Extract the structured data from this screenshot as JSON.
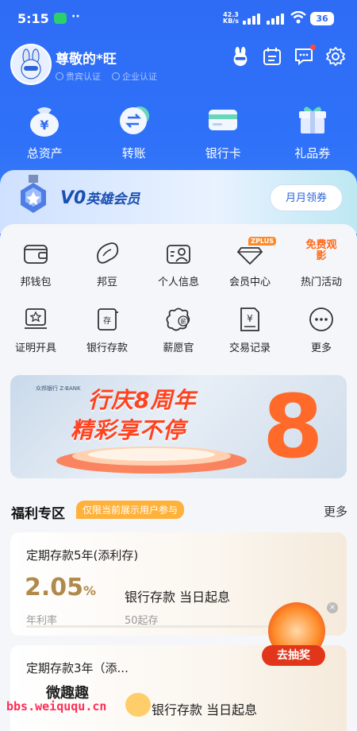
{
  "status": {
    "time": "5:15",
    "net_speed": "42.3",
    "net_unit": "KB/s",
    "battery": "36"
  },
  "profile": {
    "name": "尊敬的*旺",
    "badge_vip": "贵宾认证",
    "badge_ent": "企业认证"
  },
  "quick": [
    {
      "label": "总资产",
      "icon": "money-bag-icon"
    },
    {
      "label": "转账",
      "icon": "transfer-icon"
    },
    {
      "label": "银行卡",
      "icon": "bank-card-icon"
    },
    {
      "label": "礼品券",
      "icon": "gift-icon"
    }
  ],
  "vip": {
    "level": "V0",
    "title": "英雄会员",
    "button": "月月领券"
  },
  "services": [
    {
      "label": "邦钱包",
      "icon": "wallet-icon"
    },
    {
      "label": "邦豆",
      "icon": "bean-icon"
    },
    {
      "label": "个人信息",
      "icon": "profile-card-icon"
    },
    {
      "label": "会员中心",
      "icon": "diamond-icon",
      "tag": "ZPLUS"
    },
    {
      "label": "热门活动",
      "icon": "hot-activity-icon",
      "tag": "免费观影"
    },
    {
      "label": "证明开具",
      "icon": "certificate-icon"
    },
    {
      "label": "银行存款",
      "icon": "deposit-book-icon"
    },
    {
      "label": "薪愿官",
      "icon": "salary-wish-icon"
    },
    {
      "label": "交易记录",
      "icon": "transaction-record-icon"
    },
    {
      "label": "更多",
      "icon": "more-dots-icon"
    }
  ],
  "banner": {
    "logo": "众邦银行 Z-BANK",
    "line1": "行庆8周年",
    "line2": "精彩享不停",
    "big_digit": "8"
  },
  "welfare": {
    "title": "福利专区",
    "tag": "仅限当前展示用户参与",
    "more": "更多"
  },
  "products": [
    {
      "title": "定期存款5年(添利存)",
      "rate": "2.05",
      "unit": "%",
      "rate_label": "年利率",
      "product": "银行存款 当日起息",
      "min": "50起存"
    },
    {
      "title": "定期存款3年（添...",
      "product": "银行存款 当日起息"
    }
  ],
  "lottery": {
    "label": "去抽奖"
  },
  "watermark": {
    "name": "微趣趣",
    "url": "bbs.weiququ.cn"
  }
}
